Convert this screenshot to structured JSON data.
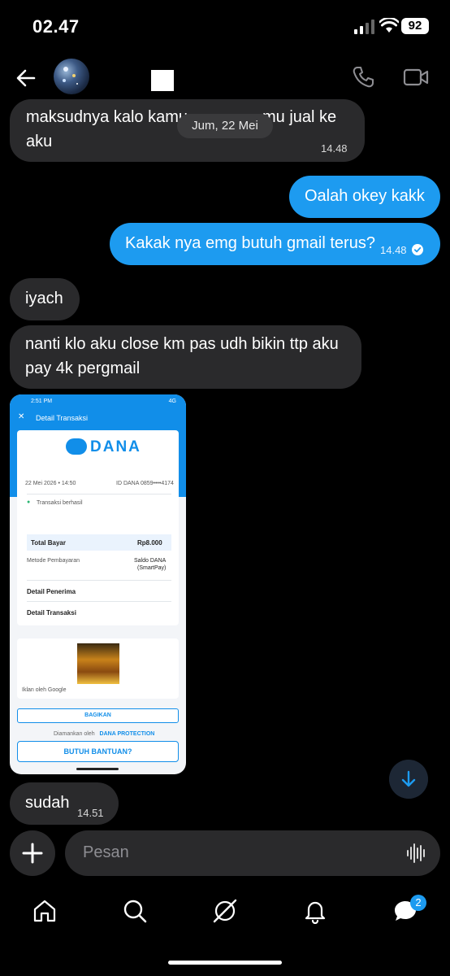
{
  "status_bar": {
    "time": "02.47",
    "battery": "92"
  },
  "header": {
    "back_icon": "arrow-left-icon",
    "avatar": "contact-avatar",
    "call_icon": "phone-icon",
    "video_icon": "video-camera-icon"
  },
  "date_separator": "Jum, 22 Mei",
  "messages": [
    {
      "direction": "in",
      "line1": "maksudnya kalo kamu",
      "line1_end": "mu jual ke",
      "line2": "aku",
      "time": "14.48"
    },
    {
      "direction": "out",
      "text": "Oalah okey kakk"
    },
    {
      "direction": "out",
      "text": "Kakak nya emg butuh gmail terus?",
      "time": "14.48",
      "status": "read"
    },
    {
      "direction": "in",
      "text": "iyach"
    },
    {
      "direction": "in",
      "line1": "nanti klo aku close km pas udh bikin ttp aku",
      "line2": "pay 4k pergmail"
    },
    {
      "direction": "in",
      "text": "sudah",
      "time": "14.51"
    }
  ],
  "attachment": {
    "status_time": "2:51 PM",
    "status_right": "4G",
    "title": "Detail Transaksi",
    "brand": "DANA",
    "date": "22 Mei 2026 • 14:50",
    "dana_id": "ID DANA 0859••••4174",
    "status": "Transaksi berhasil",
    "total_label": "Total Bayar",
    "total_value": "Rp8.000",
    "method_label": "Metode Pembayaran",
    "method_value": "Saldo DANA",
    "method_sub": "(SmartPay)",
    "receiver": "Detail Penerima",
    "transaction": "Detail Transaksi",
    "ad_note": "Iklan oleh Google",
    "share": "BAGIKAN",
    "secured_by": "Diamankan oleh",
    "protection": "DANA PROTECTION",
    "help": "BUTUH BANTUAN?"
  },
  "composer": {
    "placeholder": "Pesan"
  },
  "tabbar": {
    "badge": "2"
  },
  "colors": {
    "accent": "#1d9bf0",
    "incoming": "#2a2a2c",
    "dana": "#118ee9"
  }
}
